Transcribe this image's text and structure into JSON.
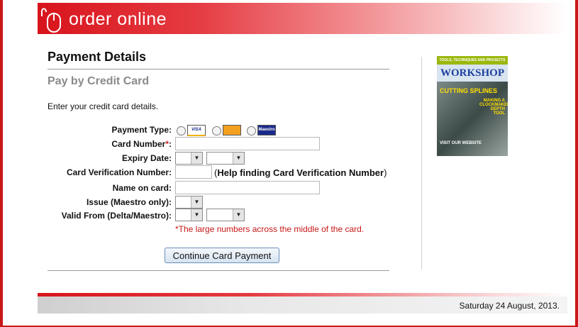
{
  "header": {
    "brand": "order online",
    "logo_icon": "mouse-icon"
  },
  "main": {
    "title": "Payment Details",
    "subtitle": "Pay by Credit Card",
    "intro": "Enter your credit card details."
  },
  "form": {
    "payment_type_label": "Payment Type:",
    "card_types": [
      "VISA",
      "MasterCard",
      "Maestro"
    ],
    "card_number_label": "Card Number",
    "required_mark": "*",
    "colon": ":",
    "expiry_label": "Expiry Date:",
    "cvn_label": "Card Verification Number:",
    "cvn_help_open": "(",
    "cvn_help_link": "Help finding Card Verification Number",
    "cvn_help_close": ")",
    "name_label": "Name on card:",
    "issue_label": "Issue (Maestro only):",
    "valid_from_label": "Valid From (Delta/Maestro):",
    "note": "*The large numbers across the middle of the card.",
    "submit_label": "Continue Card Payment"
  },
  "magazine": {
    "top_banner": "TOOLS, TECHNIQUES AND PROJECTS",
    "title": "WORKSHOP",
    "cover_line_1": "CUTTING SPLINES",
    "cover_line_2": "MAKING A CLOCKMAKER'S DEPTH TOOL",
    "cover_line_3": "VISIT OUR WEBSITE"
  },
  "footer": {
    "date": "Saturday 24 August, 2013."
  },
  "colors": {
    "accent": "#d8141c",
    "note": "#c81818",
    "subtitle": "#8a8a8a"
  }
}
